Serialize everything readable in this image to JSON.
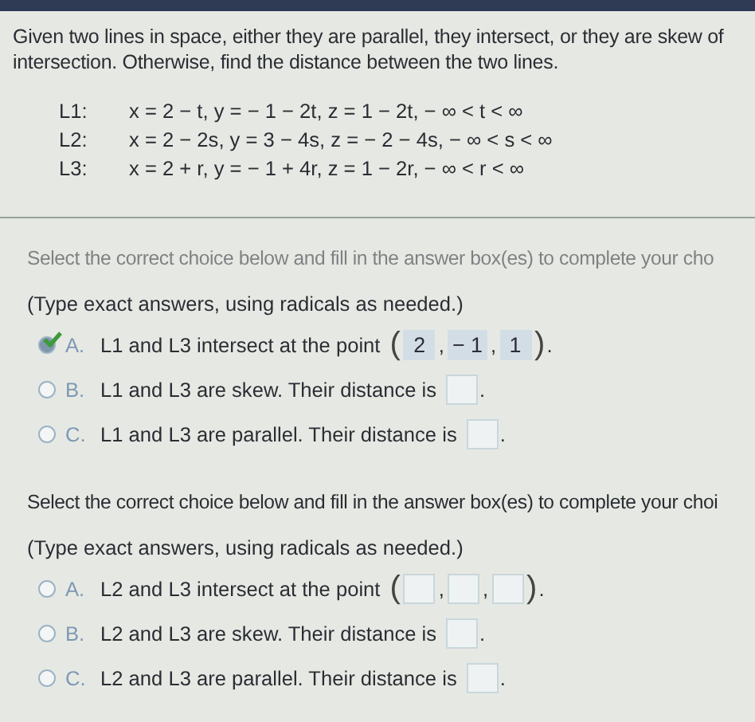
{
  "problem": {
    "text": "Given two lines in space, either they are parallel, they intersect, or they are skew of intersection. Otherwise, find the distance between the two lines."
  },
  "lines": [
    {
      "label": "L1:",
      "equation": "x = 2 − t, y = − 1 − 2t, z = 1 − 2t, − ∞ < t < ∞"
    },
    {
      "label": "L2:",
      "equation": "x = 2 − 2s, y = 3 − 4s, z = − 2 − 4s, − ∞ < s < ∞"
    },
    {
      "label": "L3:",
      "equation": "x = 2 + r, y = − 1 + 4r, z = 1 − 2r, − ∞ < r < ∞"
    }
  ],
  "parts": [
    {
      "instruction": "Select the correct choice below and fill in the answer box(es) to complete your cho",
      "note": "(Type exact answers, using radicals as needed.)",
      "choices": [
        {
          "letter": "A.",
          "kind": "point",
          "text": "L1 and L3 intersect at the point",
          "open": "(",
          "separators": [
            ",",
            ","
          ],
          "close": ")",
          "values": [
            "2",
            "− 1",
            "1"
          ],
          "end": ".",
          "selected": true
        },
        {
          "letter": "B.",
          "kind": "distance",
          "text": "L1 and L3 are skew. Their distance is",
          "end": ".",
          "selected": false
        },
        {
          "letter": "C.",
          "kind": "distance",
          "text": "L1 and L3 are parallel. Their distance is",
          "end": ".",
          "selected": false
        }
      ]
    },
    {
      "instruction": "Select the correct choice below and fill in the answer box(es) to complete your choi",
      "note": "(Type exact answers, using radicals as needed.)",
      "choices": [
        {
          "letter": "A.",
          "kind": "point",
          "text": "L2 and L3 intersect at the point",
          "open": "(",
          "separators": [
            ",",
            ","
          ],
          "close": ")",
          "end": ".",
          "selected": false
        },
        {
          "letter": "B.",
          "kind": "distance",
          "text": "L2 and L3 are skew. Their distance is",
          "end": ".",
          "selected": false
        },
        {
          "letter": "C.",
          "kind": "distance",
          "text": "L2 and L3 are parallel. Their distance is",
          "end": ".",
          "selected": false
        }
      ]
    }
  ]
}
